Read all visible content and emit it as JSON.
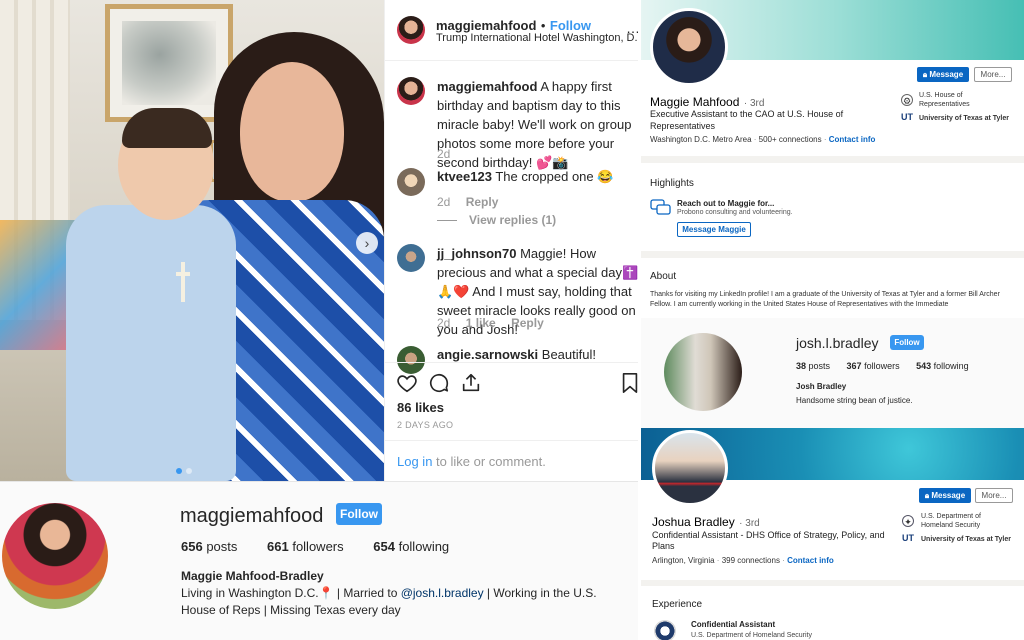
{
  "ig_post": {
    "header": {
      "username": "maggiemahfood",
      "separator": "•",
      "follow_label": "Follow",
      "location": "Trump International Hotel Washington, D.C.",
      "more_icon": "ellipsis-icon"
    },
    "comments": [
      {
        "user": "maggiemahfood",
        "text": "A happy first birthday and baptism day to this miracle baby! We'll work on group photos some more before your second birthday! 💕📸",
        "age": "2d"
      },
      {
        "user": "ktvee123",
        "text": "The cropped one 😂",
        "age": "2d",
        "reply": "Reply",
        "view_replies": "View replies (1)"
      },
      {
        "user": "jj_johnson70",
        "text": "Maggie! How precious and what a special day✝️🙏❤️ And I must say, holding that sweet miracle looks really good on you and Josh!",
        "age": "2d",
        "likes": "1 like",
        "reply": "Reply"
      },
      {
        "user": "angie.sarnowski",
        "text": "Beautiful!"
      }
    ],
    "likes": "86 likes",
    "date": "2 DAYS AGO",
    "login_link": "Log in",
    "login_rest": " to like or comment.",
    "icons": [
      "heart-icon",
      "comment-icon",
      "share-icon",
      "bookmark-icon"
    ]
  },
  "ig_profile": {
    "username": "maggiemahfood",
    "follow_label": "Follow",
    "posts_count": "656",
    "posts_label": " posts",
    "followers_count": "661",
    "followers_label": " followers",
    "following_count": "654",
    "following_label": " following",
    "full_name": "Maggie Mahfood-Bradley",
    "bio_part1": "Living in Washington D.C.📍 | Married to ",
    "bio_mention": "@josh.l.bradley",
    "bio_part2": " | Working in the U.S. House of Reps | Missing Texas every day"
  },
  "li_maggie": {
    "message_label": "Message",
    "more_label": "More...",
    "name": "Maggie Mahfood",
    "degree": "· 3rd",
    "headline": "Executive Assistant to the CAO at U.S. House of Representatives",
    "location": "Washington D.C. Metro Area",
    "connections": "500+ connections",
    "contact_info": "Contact info",
    "org1": "U.S. House of Representatives",
    "org2": "University of Texas at Tyler",
    "highlights_title": "Highlights",
    "highlight_head": "Reach out to Maggie for...",
    "highlight_sub": "Probono consulting and volunteering.",
    "highlight_btn": "Message Maggie",
    "about_title": "About",
    "about_text": "Thanks for visiting my LinkedIn profile! I am a graduate of the University of Texas at Tyler and a former Bill Archer Fellow. I am currently working in the United States House of Representatives with the Immediate"
  },
  "ig_josh": {
    "username": "josh.l.bradley",
    "follow_label": "Follow",
    "posts_count": "38",
    "posts_label": " posts",
    "followers_count": "367",
    "followers_label": " followers",
    "following_count": "543",
    "following_label": " following",
    "full_name": "Josh Bradley",
    "bio": "Handsome string bean of justice."
  },
  "li_josh": {
    "message_label": "Message",
    "more_label": "More...",
    "name": "Joshua Bradley",
    "degree": "· 3rd",
    "headline": "Confidential Assistant - DHS Office of Strategy, Policy, and Plans",
    "location": "Arlington, Virginia",
    "connections": "399 connections",
    "contact_info": "Contact info",
    "org1": "U.S. Department of Homeland Security",
    "org2": "University of Texas at Tyler",
    "experience_title": "Experience",
    "exp_role": "Confidential Assistant",
    "exp_org": "U.S. Department of Homeland Security"
  },
  "colors": {
    "ig_blue": "#3897f0",
    "li_blue": "#0a66c2",
    "ig_text": "#262626",
    "ig_muted": "#999999"
  }
}
